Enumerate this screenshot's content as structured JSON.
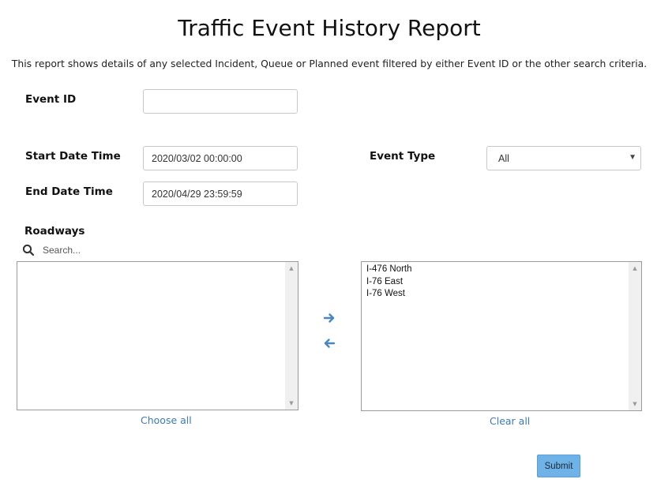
{
  "page": {
    "title": "Traffic Event History Report",
    "description": "This report shows details of any selected Incident, Queue or Planned event filtered by either Event ID or the other search criteria."
  },
  "filters": {
    "event_id": {
      "label": "Event ID",
      "value": ""
    },
    "start_date_time": {
      "label": "Start Date Time",
      "value": "2020/03/02 00:00:00"
    },
    "end_date_time": {
      "label": "End Date Time",
      "value": "2020/04/29 23:59:59"
    },
    "event_type": {
      "label": "Event Type",
      "selected": "All"
    }
  },
  "roadways": {
    "label": "Roadways",
    "search_placeholder": "Search...",
    "available": [],
    "selected": [
      "I-476 North",
      "I-76 East",
      "I-76 West"
    ],
    "choose_all_label": "Choose all",
    "clear_all_label": "Clear all"
  },
  "actions": {
    "submit_label": "Submit"
  },
  "colors": {
    "accent": "#3a7ab8",
    "submit_bg": "#6fb2e8"
  },
  "icons": {
    "search": "search-icon",
    "move_right": "arrow-right-icon",
    "move_left": "arrow-left-icon",
    "dropdown": "caret-down-icon"
  }
}
